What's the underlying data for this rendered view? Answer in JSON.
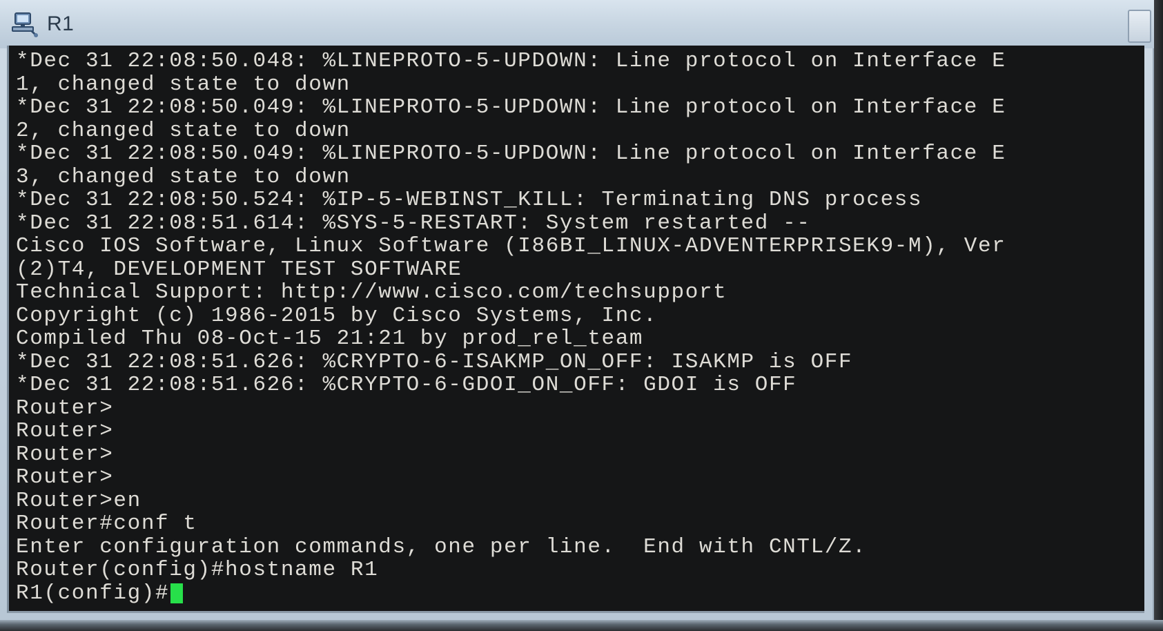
{
  "window": {
    "title": "R1",
    "icon": "network-device-icon"
  },
  "terminal": {
    "lines": [
      "*Dec 31 22:08:50.048: %LINEPROTO-5-UPDOWN: Line protocol on Interface E",
      "1, changed state to down",
      "*Dec 31 22:08:50.049: %LINEPROTO-5-UPDOWN: Line protocol on Interface E",
      "2, changed state to down",
      "*Dec 31 22:08:50.049: %LINEPROTO-5-UPDOWN: Line protocol on Interface E",
      "3, changed state to down",
      "*Dec 31 22:08:50.524: %IP-5-WEBINST_KILL: Terminating DNS process",
      "*Dec 31 22:08:51.614: %SYS-5-RESTART: System restarted --",
      "Cisco IOS Software, Linux Software (I86BI_LINUX-ADVENTERPRISEK9-M), Ver",
      "(2)T4, DEVELOPMENT TEST SOFTWARE",
      "Technical Support: http://www.cisco.com/techsupport",
      "Copyright (c) 1986-2015 by Cisco Systems, Inc.",
      "Compiled Thu 08-Oct-15 21:21 by prod_rel_team",
      "*Dec 31 22:08:51.626: %CRYPTO-6-ISAKMP_ON_OFF: ISAKMP is OFF",
      "*Dec 31 22:08:51.626: %CRYPTO-6-GDOI_ON_OFF: GDOI is OFF",
      "Router>",
      "Router>",
      "Router>",
      "Router>",
      "Router>en",
      "Router#conf t",
      "Enter configuration commands, one per line.  End with CNTL/Z.",
      "Router(config)#hostname R1"
    ],
    "prompt": "R1(config)#",
    "cursor_color": "#27e04a",
    "background_color": "#151617",
    "text_color": "#dedcd6"
  }
}
